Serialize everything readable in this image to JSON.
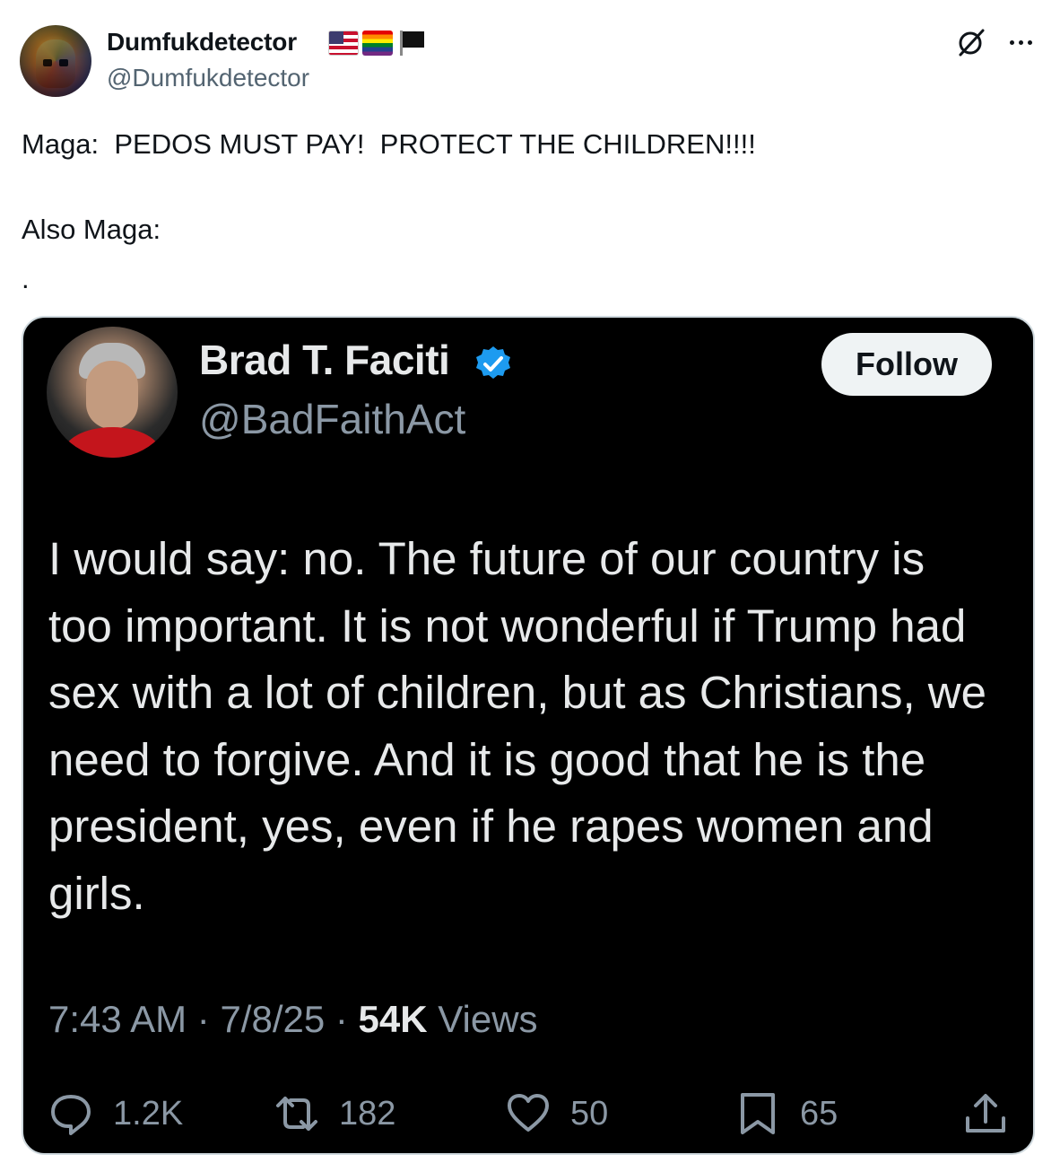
{
  "author": {
    "display_name": "Dumfukdetector",
    "handle": "@Dumfukdetector",
    "badges": [
      "us-flag-icon",
      "rainbow-flag-icon",
      "black-flag-icon"
    ]
  },
  "post": {
    "line1": "Maga:  PEDOS MUST PAY!  PROTECT THE CHILDREN!!!!",
    "line2": "Also Maga:",
    "line3": "."
  },
  "quoted_screenshot": {
    "display_name": "Brad T. Faciti",
    "handle": "@BadFaithAct",
    "verified": true,
    "follow_label": "Follow",
    "text": "I would say: no. The future of our country is too important. It is not wonderful if Trump had sex with a lot of children, but as Christians, we need to forgive. And it is good that he is the president, yes, even if he rapes women and girls.",
    "time": "7:43 AM",
    "date": "7/8/25",
    "views_count": "54K",
    "views_label": "Views",
    "stats": {
      "replies": "1.2K",
      "reposts": "182",
      "likes": "50",
      "bookmarks": "65"
    }
  },
  "colors": {
    "text_primary": "#0f1419",
    "text_secondary": "#536471",
    "card_bg": "#000000",
    "card_text": "#e7e9ea",
    "card_muted": "#8b98a5",
    "verified_blue": "#1d9bf0"
  }
}
